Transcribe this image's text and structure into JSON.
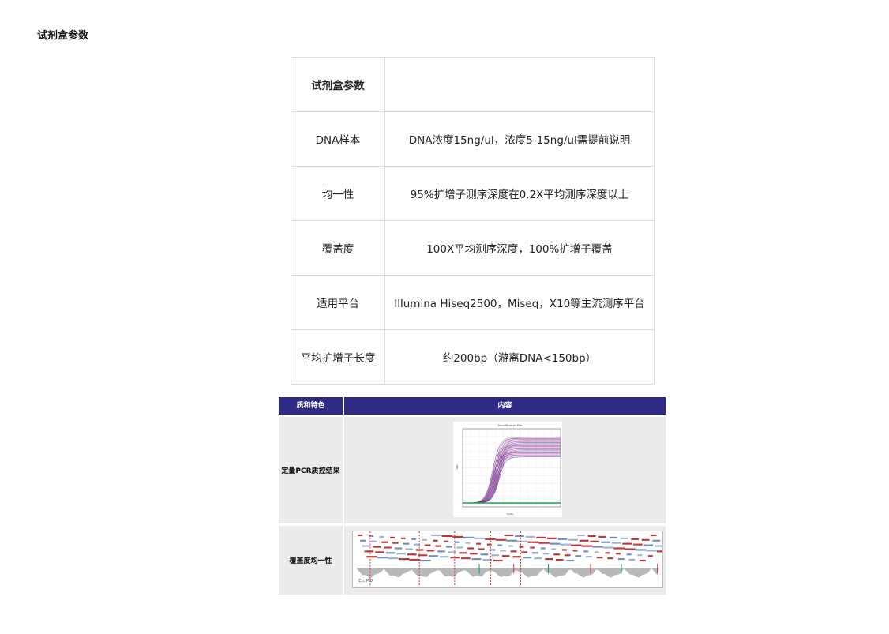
{
  "section_title": "试剂盒参数",
  "params_table": {
    "header": {
      "key": "试剂盒参数",
      "value": ""
    },
    "rows": [
      {
        "key": "DNA样本",
        "value": "DNA浓度15ng/ul，浓度5-15ng/ul需提前说明"
      },
      {
        "key": "均一性",
        "value": "95%扩增子测序深度在0.2X平均测序深度以上"
      },
      {
        "key": "覆盖度",
        "value": "100X平均测序深度，100%扩增子覆盖"
      },
      {
        "key": "适用平台",
        "value": "Illumina Hiseq2500，Miseq，X10等主流测序平台"
      },
      {
        "key": "平均扩增子长度",
        "value": "约200bp（游离DNA<150bp）"
      }
    ]
  },
  "features_table": {
    "header": {
      "col1": "质和特色",
      "col2": "内容"
    },
    "rows": [
      {
        "label": "定量PCR质控结果",
        "figure": "amplification-plot"
      },
      {
        "label": "覆盖度均一性",
        "figure": "coverage-uniformity-plot"
      }
    ],
    "pcr_plot": {
      "title": "Amplification Plot",
      "xlabel": "Cycle",
      "ylabel": "ΔRn"
    },
    "coverage_plot": {
      "label": "Ch: PID"
    }
  },
  "colors": {
    "header_bg": "#2e2a86",
    "row_bg": "#ebebeb",
    "border": "#dcdcdc"
  }
}
